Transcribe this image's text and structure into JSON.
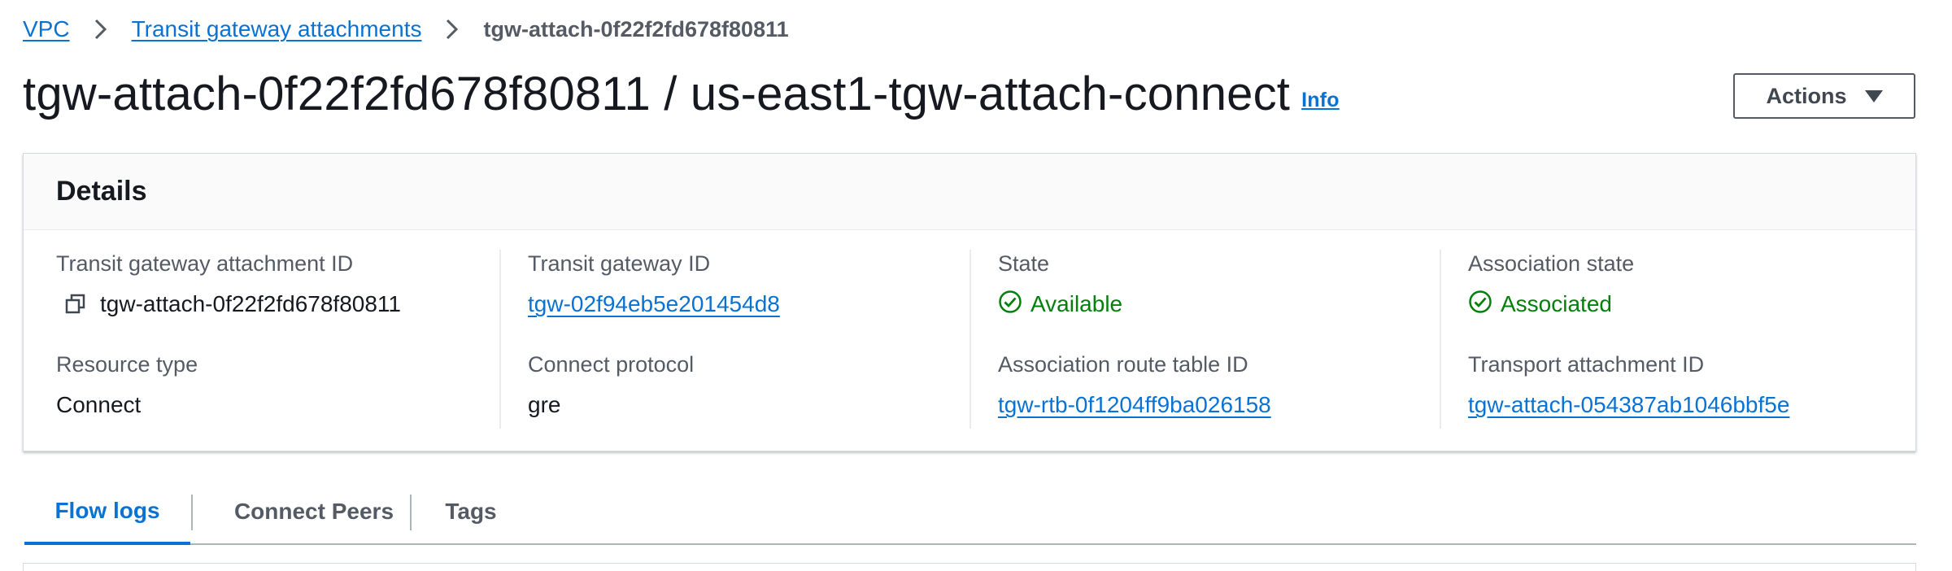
{
  "breadcrumb": {
    "items": [
      {
        "label": "VPC"
      },
      {
        "label": "Transit gateway attachments"
      }
    ],
    "current": "tgw-attach-0f22f2fd678f80811"
  },
  "header": {
    "title": "tgw-attach-0f22f2fd678f80811 / us-east1-tgw-attach-connect",
    "info_label": "Info",
    "actions_label": "Actions"
  },
  "details": {
    "title": "Details",
    "fields": {
      "attachment_id": {
        "label": "Transit gateway attachment ID",
        "value": "tgw-attach-0f22f2fd678f80811",
        "icon": "copy-icon"
      },
      "tgw_id": {
        "label": "Transit gateway ID",
        "value": "tgw-02f94eb5e201454d8"
      },
      "state": {
        "label": "State",
        "value": "Available",
        "icon": "check-circle-icon"
      },
      "association_state": {
        "label": "Association state",
        "value": "Associated",
        "icon": "check-circle-icon"
      },
      "resource_type": {
        "label": "Resource type",
        "value": "Connect"
      },
      "connect_protocol": {
        "label": "Connect protocol",
        "value": "gre"
      },
      "route_table_id": {
        "label": "Association route table ID",
        "value": "tgw-rtb-0f1204ff9ba026158"
      },
      "transport_attachment_id": {
        "label": "Transport attachment ID",
        "value": "tgw-attach-054387ab1046bbf5e"
      }
    }
  },
  "tabs": [
    {
      "label": "Flow logs",
      "active": true
    },
    {
      "label": "Connect Peers",
      "active": false
    },
    {
      "label": "Tags",
      "active": false
    }
  ],
  "colors": {
    "link": "#0972d3",
    "success": "#037f0c",
    "text": "#16191f",
    "muted": "#545b64"
  }
}
